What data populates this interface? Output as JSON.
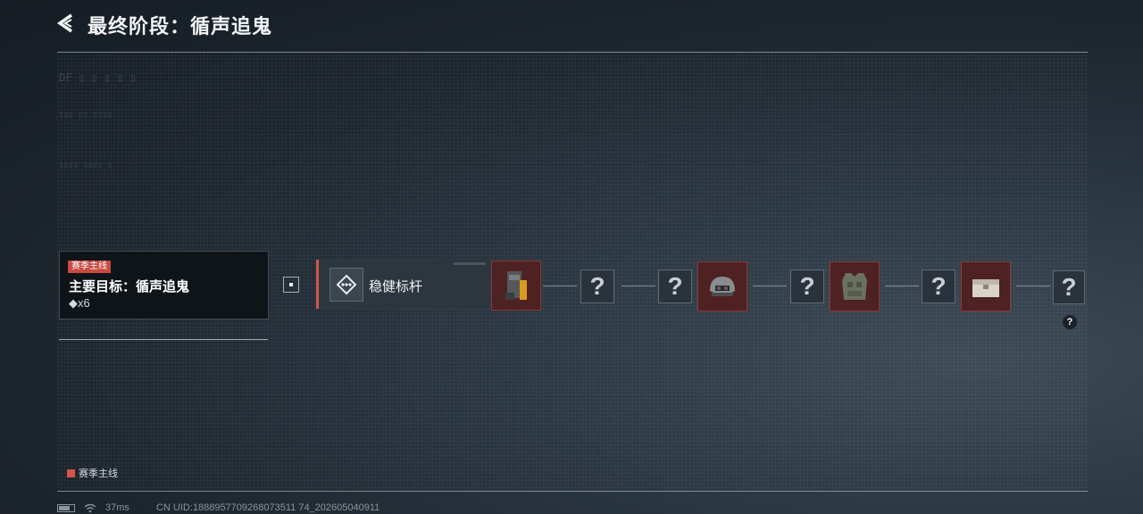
{
  "header": {
    "title": "最终阶段：循声追鬼"
  },
  "quest_card": {
    "tag": "赛季主线",
    "title": "主要目标：循声追鬼",
    "count": "◆x6"
  },
  "objective": {
    "label": "稳健标杆"
  },
  "rewards": {
    "unknown_mark": "?",
    "hint_mark": "?",
    "items": [
      "armor-rig-icon",
      "helmet-icon",
      "body-armor-icon",
      "supply-crate-icon"
    ]
  },
  "legend": {
    "label": "赛季主线",
    "color": "#d4544a"
  },
  "status": {
    "ping": "37ms",
    "uid": "CN UID:1888957709268073511 74_202605040911"
  },
  "colors": {
    "accent": "#d4544a",
    "reward_bg": "#4e2123",
    "unknown_bg": "#2a333b"
  }
}
